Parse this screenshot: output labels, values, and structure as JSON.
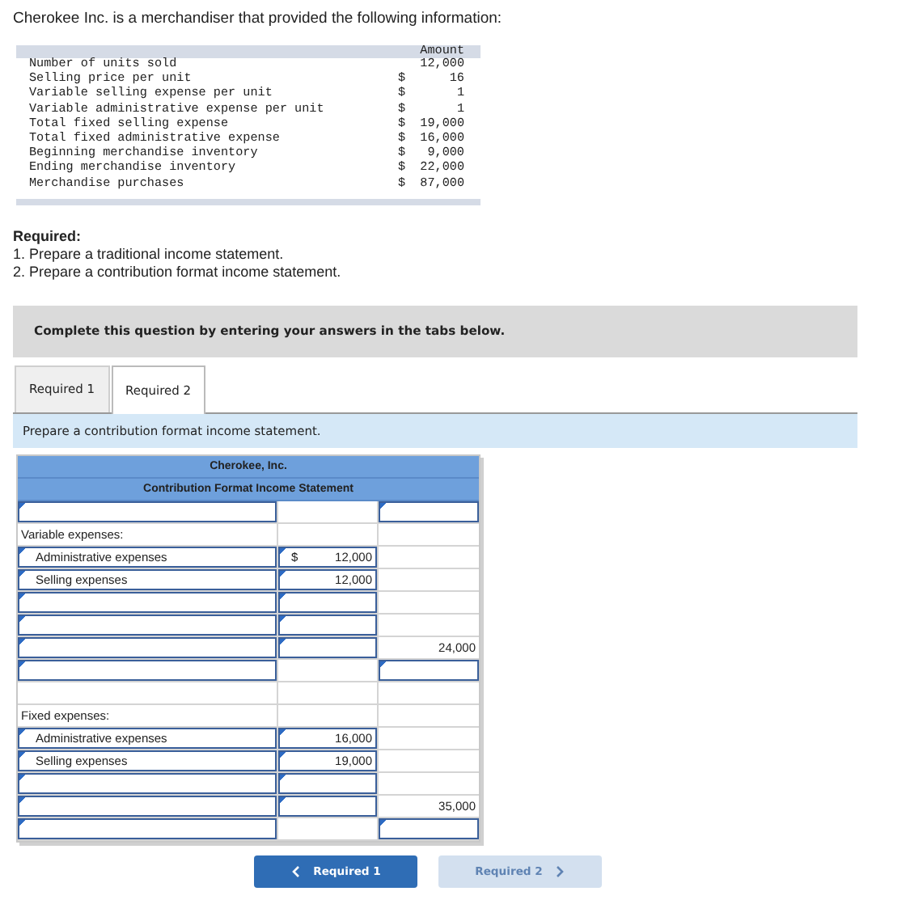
{
  "intro": "Cherokee Inc. is a merchandiser that provided the following information:",
  "data_table": {
    "column_header": "Amount",
    "rows": [
      {
        "label": "Number of units sold",
        "amount": "12,000"
      },
      {
        "label": "Selling price per unit",
        "currency": "$",
        "amount": "16"
      },
      {
        "label": "Variable selling expense per unit",
        "currency": "$",
        "amount": "1"
      },
      {
        "label": "Variable administrative expense per unit",
        "currency": "$",
        "amount": "1"
      },
      {
        "label": "Total fixed selling expense",
        "currency": "$",
        "amount": "19,000"
      },
      {
        "label": "Total fixed administrative expense",
        "currency": "$",
        "amount": "16,000"
      },
      {
        "label": "Beginning merchandise inventory",
        "currency": "$",
        "amount": "9,000"
      },
      {
        "label": "Ending merchandise inventory",
        "currency": "$",
        "amount": "22,000"
      },
      {
        "label": "Merchandise purchases",
        "currency": "$",
        "amount": "87,000"
      }
    ]
  },
  "required": {
    "heading": "Required:",
    "items": [
      "1. Prepare a traditional income statement.",
      "2. Prepare a contribution format income statement."
    ]
  },
  "instruction_banner": "Complete this question by entering your answers in the tabs below.",
  "tabs": [
    {
      "label": "Required 1",
      "selected": false
    },
    {
      "label": "Required 2",
      "selected": true
    }
  ],
  "task_prompt": "Prepare a contribution format income statement.",
  "statement": {
    "company": "Cherokee, Inc.",
    "title": "Contribution Format Income Statement",
    "rows": [
      {
        "label": {
          "kind": "input"
        },
        "middle": {
          "kind": "static"
        },
        "right": {
          "kind": "input"
        }
      },
      {
        "label": {
          "kind": "static",
          "value": "Variable expenses:"
        },
        "middle": {
          "kind": "static"
        },
        "right": {
          "kind": "static"
        }
      },
      {
        "label": {
          "kind": "input",
          "value": "Administrative expenses",
          "indented": true
        },
        "middle": {
          "kind": "input",
          "value": "12,000",
          "prefix": "$"
        },
        "right": {
          "kind": "static"
        }
      },
      {
        "label": {
          "kind": "input",
          "value": "Selling expenses",
          "indented": true
        },
        "middle": {
          "kind": "input",
          "value": "12,000"
        },
        "right": {
          "kind": "static"
        }
      },
      {
        "label": {
          "kind": "input"
        },
        "middle": {
          "kind": "input"
        },
        "right": {
          "kind": "static"
        }
      },
      {
        "label": {
          "kind": "input"
        },
        "middle": {
          "kind": "input"
        },
        "right": {
          "kind": "static"
        }
      },
      {
        "label": {
          "kind": "input"
        },
        "middle": {
          "kind": "input"
        },
        "right": {
          "kind": "static",
          "value": "24,000"
        }
      },
      {
        "label": {
          "kind": "input"
        },
        "middle": {
          "kind": "static"
        },
        "right": {
          "kind": "input"
        }
      },
      {
        "label": {
          "kind": "static"
        },
        "middle": {
          "kind": "static"
        },
        "right": {
          "kind": "static"
        }
      },
      {
        "label": {
          "kind": "static",
          "value": "Fixed expenses:"
        },
        "middle": {
          "kind": "static"
        },
        "right": {
          "kind": "static"
        }
      },
      {
        "label": {
          "kind": "input",
          "value": "Administrative expenses",
          "indented": true
        },
        "middle": {
          "kind": "input",
          "value": "16,000"
        },
        "right": {
          "kind": "static"
        }
      },
      {
        "label": {
          "kind": "input",
          "value": "Selling expenses",
          "indented": true
        },
        "middle": {
          "kind": "input",
          "value": "19,000"
        },
        "right": {
          "kind": "static"
        }
      },
      {
        "label": {
          "kind": "input"
        },
        "middle": {
          "kind": "input"
        },
        "right": {
          "kind": "static"
        }
      },
      {
        "label": {
          "kind": "input"
        },
        "middle": {
          "kind": "input"
        },
        "right": {
          "kind": "static",
          "value": "35,000"
        }
      },
      {
        "label": {
          "kind": "input"
        },
        "middle": {
          "kind": "static"
        },
        "right": {
          "kind": "input"
        }
      }
    ]
  },
  "nav_buttons": [
    {
      "label": "Required 1",
      "kind": "prev",
      "disabled": false
    },
    {
      "label": "Required 2",
      "kind": "next",
      "disabled": true
    }
  ]
}
